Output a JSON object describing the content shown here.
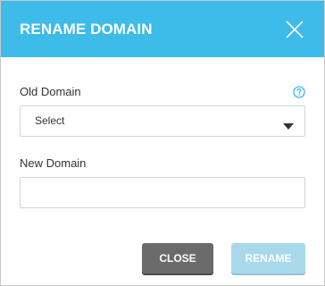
{
  "dialog": {
    "title": "RENAME DOMAIN",
    "close_icon": "close-icon",
    "header_color": "#3dbbe9"
  },
  "form": {
    "old_domain": {
      "label": "Old Domain",
      "help_icon": "help-question-icon",
      "selected_value": "Select",
      "caret_icon": "caret-down-icon"
    },
    "new_domain": {
      "label": "New Domain",
      "value": ""
    }
  },
  "buttons": {
    "close_label": "CLOSE",
    "rename_label": "RENAME",
    "close_color": "#6b6b6b",
    "rename_color": "#a8d9ea"
  }
}
